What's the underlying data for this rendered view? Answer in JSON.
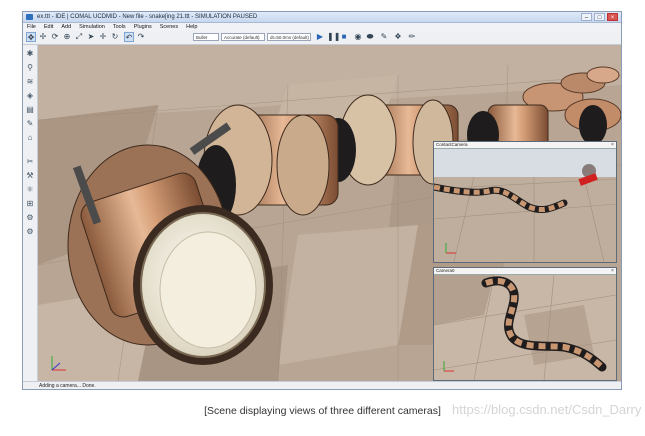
{
  "window": {
    "title": "ex.ttt - IDE | COMAL UCDMID - New file - snake[ing 21.ttt - SIMULATION PAUSED",
    "min": "–",
    "max": "□",
    "close": "×"
  },
  "menu": [
    "File",
    "Edit",
    "Add",
    "Simulation",
    "Tools",
    "Plugins",
    "Scenes",
    "Help"
  ],
  "toolbar": {
    "select_engine": "Bullet",
    "select_accuracy": "Accurate (default)",
    "select_timestep": "dt=50.0ms (default)"
  },
  "cameras": {
    "main_view": "Main camera view",
    "contact_title": "ContactCamera",
    "camera_title": "Camera0"
  },
  "status": "Adding a camera... Done.",
  "caption": "[Scene displaying views of three different cameras]",
  "watermark": "https://blog.csdn.net/Csdn_Darry",
  "colors": {
    "floor_light": "#c9b7a4",
    "floor_dark": "#a89382",
    "module_wood": "#c99672",
    "connector": "#1e1c1c",
    "sky": "#d7dde3"
  },
  "icons": {
    "toolbar": [
      "move-icon",
      "pan-icon",
      "rotate-icon",
      "zoom-icon",
      "fit-icon",
      "select-icon",
      "shift-icon",
      "rotate-object-icon",
      "undo-icon",
      "redo-icon",
      "play-icon",
      "pause-icon",
      "stop-icon",
      "camera-icon"
    ],
    "left": [
      "wrench-icon",
      "search-icon",
      "layers-icon",
      "model-browser-icon",
      "hierarchy-icon",
      "script-icon",
      "edit-icon",
      "filter-icon",
      "path-icon",
      "physics-icon",
      "lock-icon",
      "gear-icon",
      "settings-icon"
    ]
  }
}
